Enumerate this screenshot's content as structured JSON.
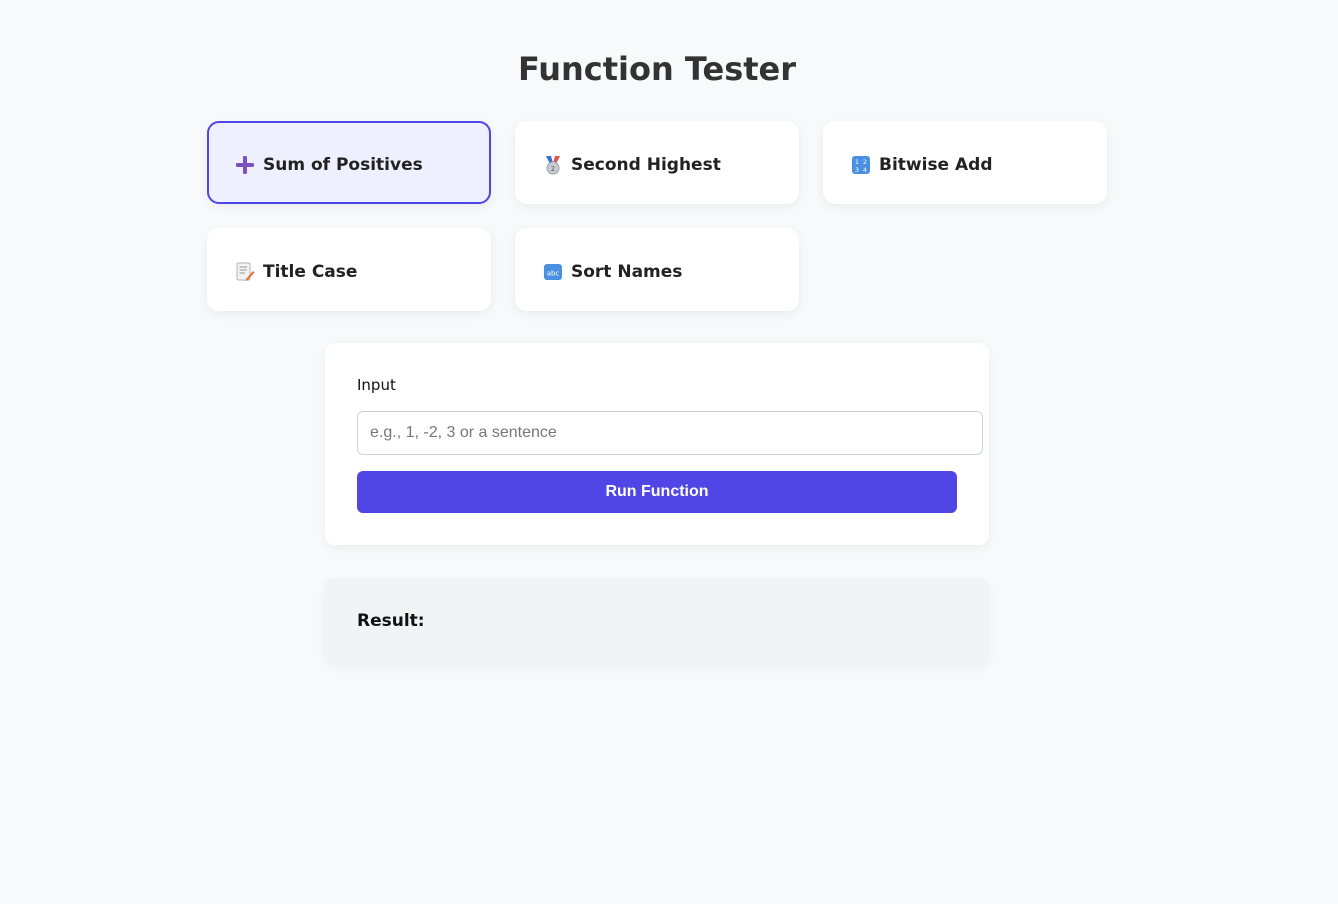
{
  "page": {
    "title": "Function Tester"
  },
  "functions": [
    {
      "label": "Sum of Positives",
      "icon": "plus-icon",
      "active": true
    },
    {
      "label": "Second Highest",
      "icon": "second-place-medal-icon",
      "active": false
    },
    {
      "label": "Bitwise Add",
      "icon": "numbers-1234-icon",
      "active": false
    },
    {
      "label": "Title Case",
      "icon": "memo-pencil-icon",
      "active": false
    },
    {
      "label": "Sort Names",
      "icon": "abc-letters-icon",
      "active": false
    }
  ],
  "input": {
    "label": "Input",
    "placeholder": "e.g., 1, -2, 3 or a sentence",
    "value": ""
  },
  "run_button": {
    "label": "Run Function"
  },
  "result": {
    "label": "Result:",
    "value": ""
  },
  "colors": {
    "accent": "#5046e5",
    "active_card_bg": "#eef1fd",
    "page_bg": "#f8f9fb",
    "result_bg": "#f2f3f5"
  }
}
